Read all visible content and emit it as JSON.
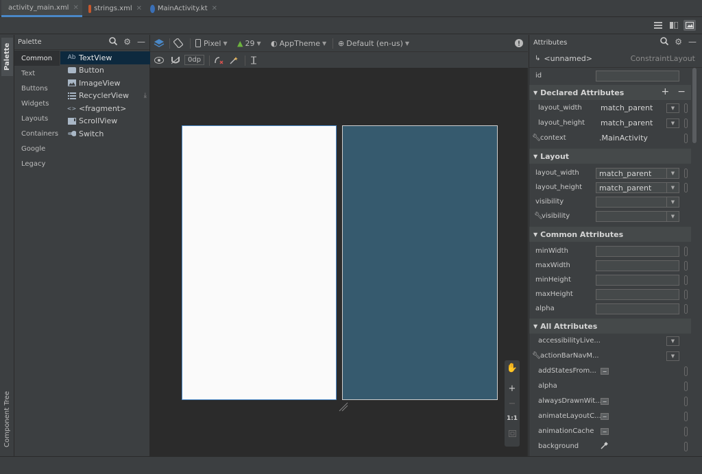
{
  "tabs": [
    {
      "label": "activity_main.xml",
      "icon": "xml-file-icon",
      "active": true
    },
    {
      "label": "strings.xml",
      "icon": "xml-file-icon",
      "active": false
    },
    {
      "label": "MainActivity.kt",
      "icon": "kotlin-file-icon",
      "active": false
    }
  ],
  "left_strip": {
    "palette": "Palette",
    "component_tree": "Component Tree"
  },
  "palette": {
    "title": "Palette",
    "categories": [
      "Common",
      "Text",
      "Buttons",
      "Widgets",
      "Layouts",
      "Containers",
      "Google",
      "Legacy"
    ],
    "selected_category": "Common",
    "widgets": [
      {
        "label": "TextView",
        "icon": "Ab"
      },
      {
        "label": "Button",
        "icon": "button-icon"
      },
      {
        "label": "ImageView",
        "icon": "image-icon"
      },
      {
        "label": "RecyclerView",
        "icon": "list-icon"
      },
      {
        "label": "<fragment>",
        "icon": "<>"
      },
      {
        "label": "ScrollView",
        "icon": "scroll-icon"
      },
      {
        "label": "Switch",
        "icon": "switch-icon"
      }
    ]
  },
  "toolbar": {
    "device": "Pixel",
    "api": "29",
    "theme": "AppTheme",
    "locale": "Default (en-us)",
    "margin": "0dp"
  },
  "zoom": {
    "ratio": "1:1"
  },
  "attributes": {
    "title": "Attributes",
    "component_name": "<unnamed>",
    "component_type": "ConstraintLayout",
    "id_label": "id",
    "declared": {
      "title": "Declared Attributes",
      "rows": [
        {
          "name": "layout_width",
          "value": "match_parent"
        },
        {
          "name": "layout_height",
          "value": "match_parent"
        },
        {
          "name": "context",
          "value": ".MainActivity"
        }
      ]
    },
    "layout": {
      "title": "Layout",
      "rows": [
        {
          "name": "layout_width",
          "value": "match_parent"
        },
        {
          "name": "layout_height",
          "value": "match_parent"
        },
        {
          "name": "visibility",
          "value": ""
        },
        {
          "name": "visibility",
          "value": ""
        }
      ]
    },
    "common": {
      "title": "Common Attributes",
      "rows": [
        "minWidth",
        "maxWidth",
        "minHeight",
        "maxHeight",
        "alpha"
      ]
    },
    "all": {
      "title": "All Attributes",
      "rows": [
        "accessibilityLive...",
        "actionBarNavM...",
        "addStatesFrom...",
        "alpha",
        "alwaysDrawnWit...",
        "animateLayoutC...",
        "animationCache",
        "background"
      ]
    }
  }
}
